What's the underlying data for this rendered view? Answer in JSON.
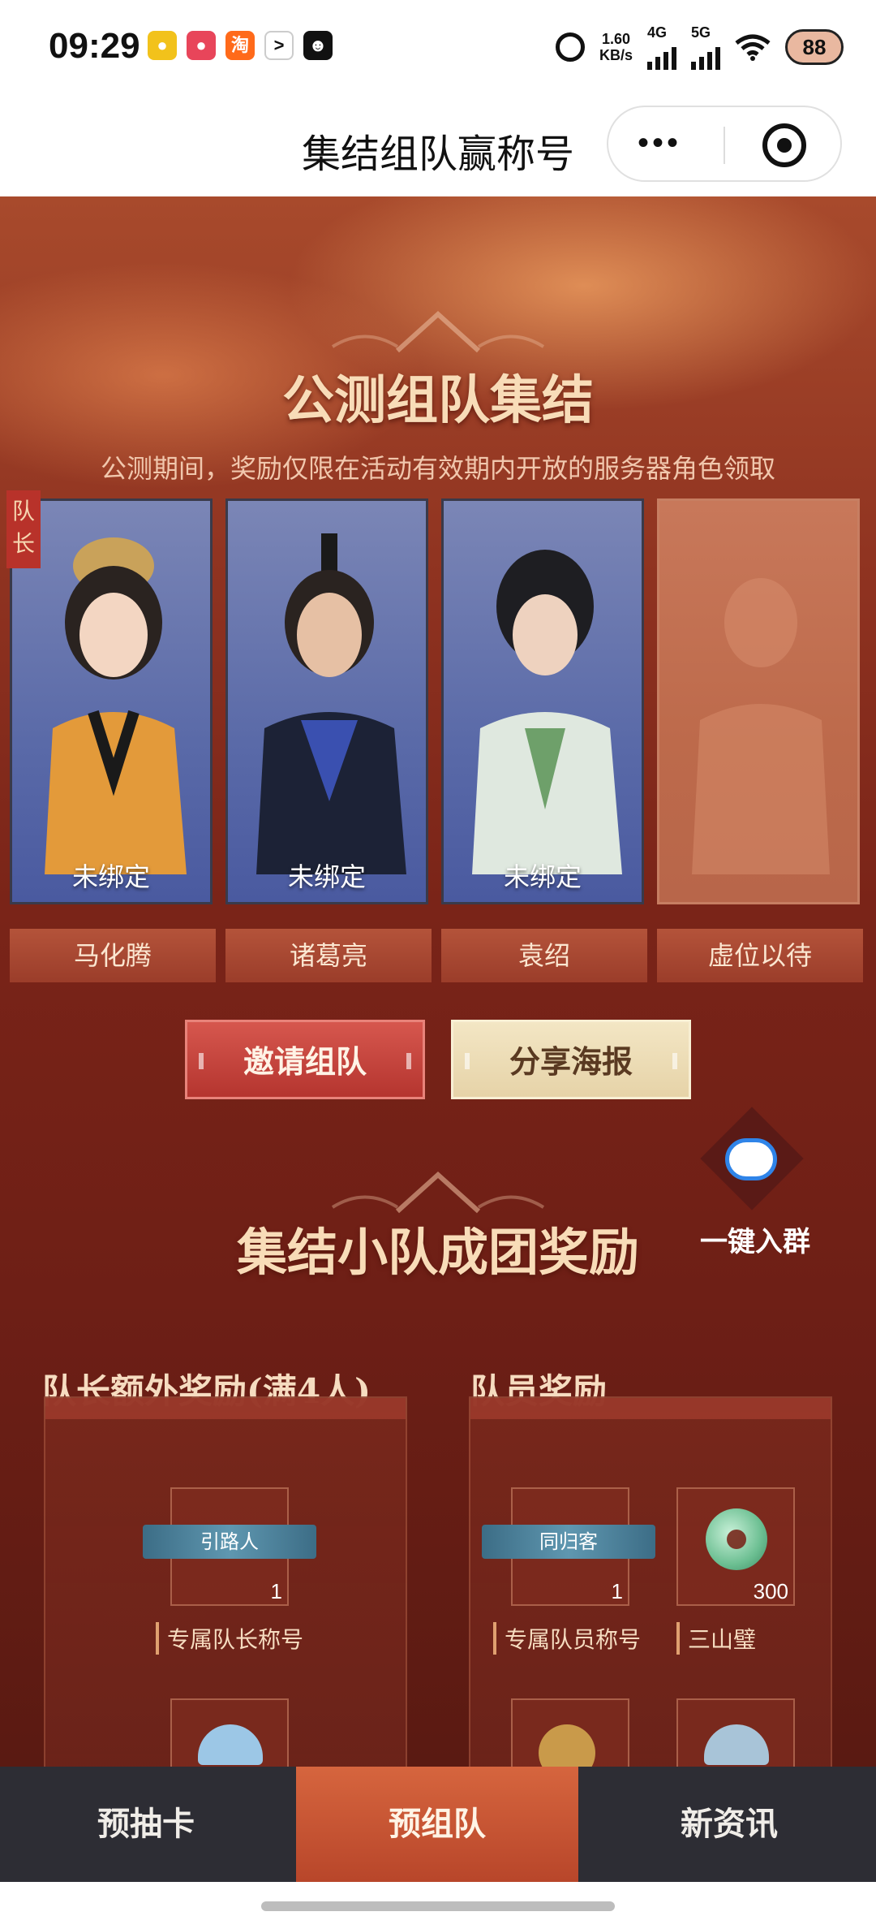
{
  "status_bar": {
    "time": "09:29",
    "net_speed": "1.60",
    "net_unit": "KB/s",
    "network_1": "4G",
    "network_2": "5G",
    "battery": "88"
  },
  "nav": {
    "title": "集结组队赢称号"
  },
  "team_section": {
    "title": "公测组队集结",
    "subtitle": "公测期间，奖励仅限在活动有效期内开放的服务器角色领取",
    "leader_tag": "队长",
    "members": [
      {
        "name": "马化腾",
        "status": "未绑定"
      },
      {
        "name": "诸葛亮",
        "status": "未绑定"
      },
      {
        "name": "袁绍",
        "status": "未绑定"
      },
      {
        "name": "虚位以待",
        "status": ""
      }
    ],
    "invite_button": "邀请组队",
    "share_button": "分享海报"
  },
  "reward_section": {
    "title": "集结小队成团奖励",
    "group_button": "一键入群",
    "leader_rewards": {
      "heading": "队长额外奖励(满4人)",
      "items": [
        {
          "ribbon": "引路人",
          "qty": "1",
          "label": "专属队长称号"
        }
      ]
    },
    "member_rewards": {
      "heading": "队员奖励",
      "items": [
        {
          "ribbon": "同归客",
          "qty": "1",
          "label": "专属队员称号"
        },
        {
          "qty": "300",
          "label": "三山璧"
        }
      ]
    }
  },
  "tabs": [
    {
      "label": "预抽卡",
      "active": false
    },
    {
      "label": "预组队",
      "active": true
    },
    {
      "label": "新资讯",
      "active": false
    }
  ],
  "colors": {
    "accent_red": "#b5352f",
    "active_tab": "#c9532f",
    "title_gold": "#f8dcb8"
  }
}
